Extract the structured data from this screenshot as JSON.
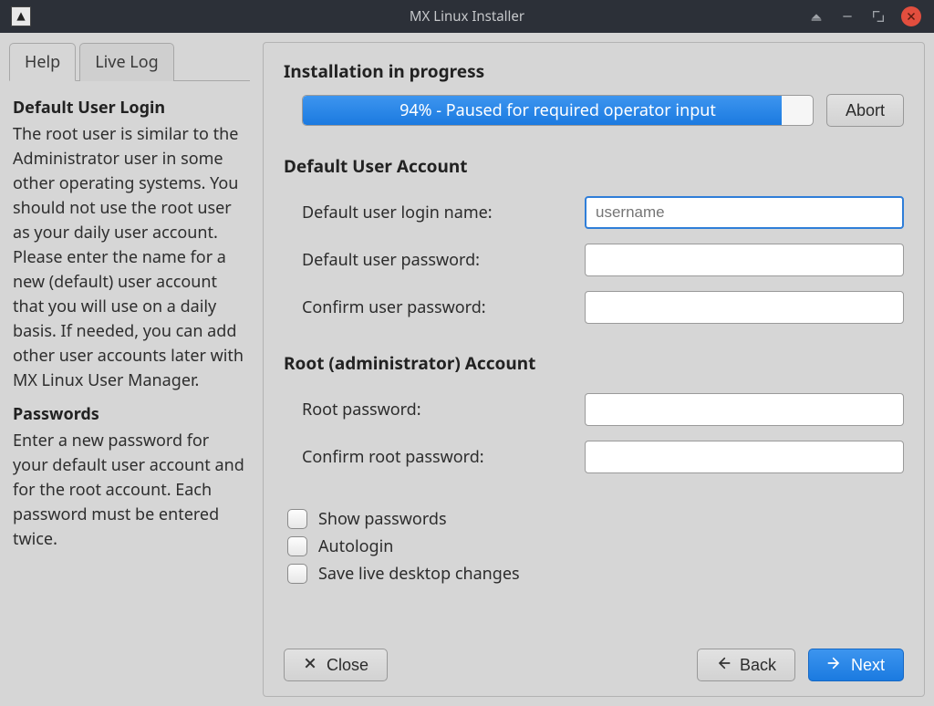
{
  "titlebar": {
    "title": "MX Linux Installer"
  },
  "tabs": {
    "help": "Help",
    "livelog": "Live Log"
  },
  "help": {
    "h1": "Default User Login",
    "p1": "The root user is similar to the Administrator user in some other operating systems. You should not use the root user as your daily user account. Please enter the name for a new (default) user account that you will use on a daily basis. If needed, you can add other user accounts later with MX Linux User Manager.",
    "h2": "Passwords",
    "p2": "Enter a new password for your default user account and for the root account. Each password must be entered twice."
  },
  "main": {
    "progress_heading": "Installation in progress",
    "progress_text": "94% - Paused for required operator input",
    "progress_percent": 94,
    "abort": "Abort",
    "user_heading": "Default User Account",
    "login_label": "Default user login name:",
    "login_placeholder": "username",
    "userpw_label": "Default user password:",
    "userpw2_label": "Confirm user password:",
    "root_heading": "Root (administrator) Account",
    "rootpw_label": "Root password:",
    "rootpw2_label": "Confirm root password:",
    "show_pw": "Show passwords",
    "autologin": "Autologin",
    "save_live": "Save live desktop changes",
    "close": "Close",
    "back": "Back",
    "next": "Next"
  }
}
